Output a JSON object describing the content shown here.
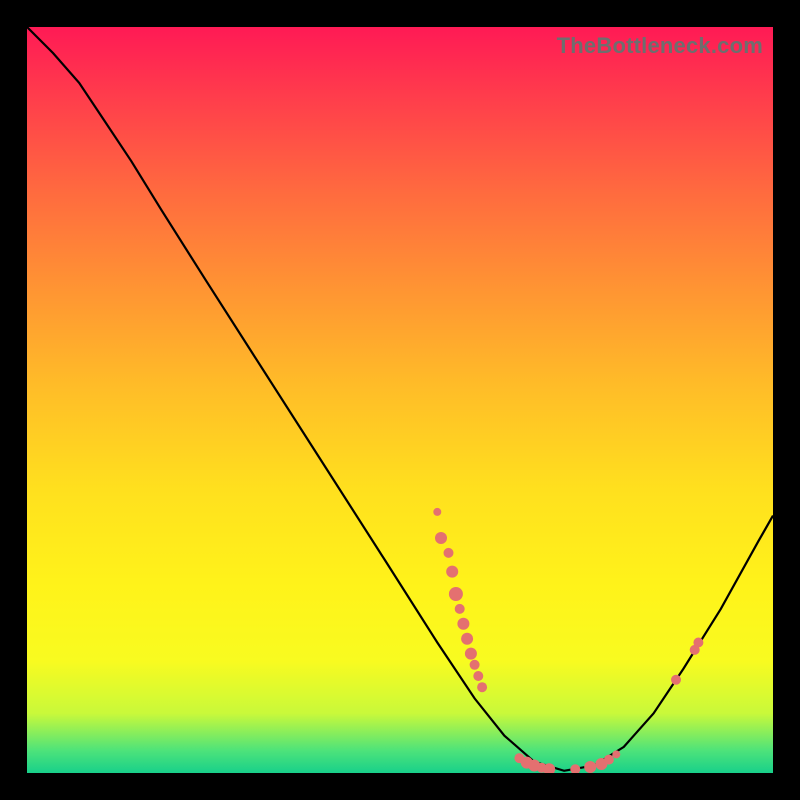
{
  "watermark": "TheBottleneck.com",
  "colors": {
    "dot": "#e47070",
    "curve": "#000000"
  },
  "chart_data": {
    "type": "line",
    "title": "",
    "xlabel": "",
    "ylabel": "",
    "xlim": [
      0,
      100
    ],
    "ylim": [
      0,
      100
    ],
    "curve": [
      {
        "x": 0.0,
        "y": 100.0
      },
      {
        "x": 3.5,
        "y": 96.5
      },
      {
        "x": 7.0,
        "y": 92.5
      },
      {
        "x": 10.0,
        "y": 88.0
      },
      {
        "x": 14.0,
        "y": 82.0
      },
      {
        "x": 18.0,
        "y": 75.5
      },
      {
        "x": 24.0,
        "y": 66.0
      },
      {
        "x": 32.0,
        "y": 53.5
      },
      {
        "x": 40.0,
        "y": 41.0
      },
      {
        "x": 48.0,
        "y": 28.5
      },
      {
        "x": 55.0,
        "y": 17.5
      },
      {
        "x": 60.0,
        "y": 10.0
      },
      {
        "x": 64.0,
        "y": 5.0
      },
      {
        "x": 68.0,
        "y": 1.5
      },
      {
        "x": 72.0,
        "y": 0.3
      },
      {
        "x": 76.0,
        "y": 1.0
      },
      {
        "x": 80.0,
        "y": 3.5
      },
      {
        "x": 84.0,
        "y": 8.0
      },
      {
        "x": 88.0,
        "y": 14.0
      },
      {
        "x": 93.0,
        "y": 22.0
      },
      {
        "x": 98.0,
        "y": 31.0
      },
      {
        "x": 100.0,
        "y": 34.5
      }
    ],
    "dots": [
      {
        "x": 55.0,
        "y": 35.0,
        "r": 4
      },
      {
        "x": 55.5,
        "y": 31.5,
        "r": 6
      },
      {
        "x": 56.5,
        "y": 29.5,
        "r": 5
      },
      {
        "x": 57.0,
        "y": 27.0,
        "r": 6
      },
      {
        "x": 57.5,
        "y": 24.0,
        "r": 7
      },
      {
        "x": 58.0,
        "y": 22.0,
        "r": 5
      },
      {
        "x": 58.5,
        "y": 20.0,
        "r": 6
      },
      {
        "x": 59.0,
        "y": 18.0,
        "r": 6
      },
      {
        "x": 59.5,
        "y": 16.0,
        "r": 6
      },
      {
        "x": 60.0,
        "y": 14.5,
        "r": 5
      },
      {
        "x": 60.5,
        "y": 13.0,
        "r": 5
      },
      {
        "x": 61.0,
        "y": 11.5,
        "r": 5
      },
      {
        "x": 66.0,
        "y": 2.0,
        "r": 5
      },
      {
        "x": 67.0,
        "y": 1.4,
        "r": 6
      },
      {
        "x": 68.0,
        "y": 1.0,
        "r": 6
      },
      {
        "x": 69.0,
        "y": 0.7,
        "r": 5
      },
      {
        "x": 70.0,
        "y": 0.5,
        "r": 6
      },
      {
        "x": 73.5,
        "y": 0.5,
        "r": 5
      },
      {
        "x": 75.5,
        "y": 0.8,
        "r": 6
      },
      {
        "x": 77.0,
        "y": 1.2,
        "r": 6
      },
      {
        "x": 78.0,
        "y": 1.8,
        "r": 5
      },
      {
        "x": 79.0,
        "y": 2.5,
        "r": 4
      },
      {
        "x": 87.0,
        "y": 12.5,
        "r": 5
      },
      {
        "x": 89.5,
        "y": 16.5,
        "r": 5
      },
      {
        "x": 90.0,
        "y": 17.5,
        "r": 5
      }
    ]
  }
}
